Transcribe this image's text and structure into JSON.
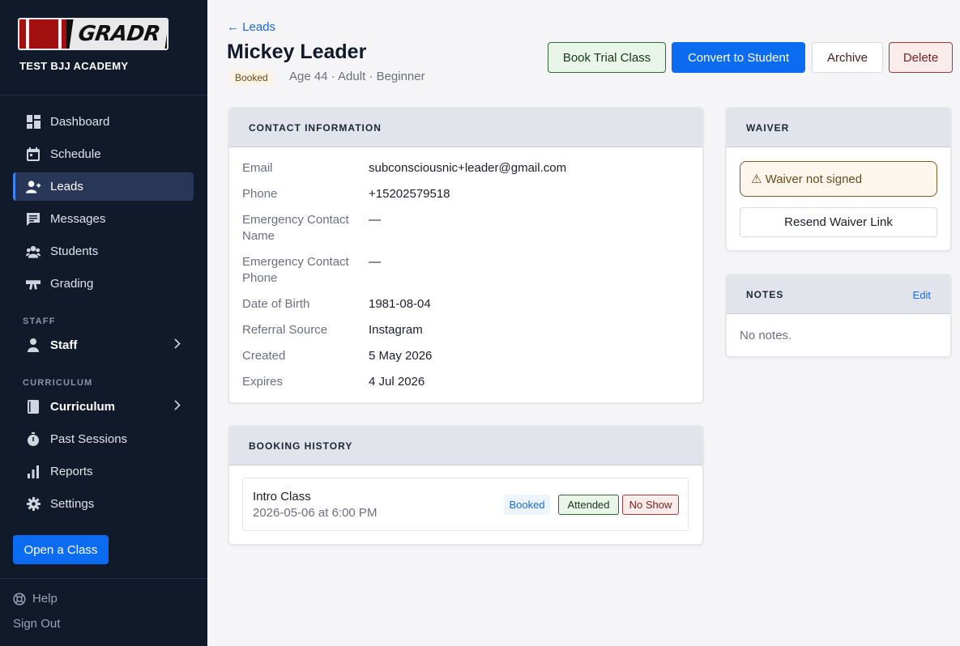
{
  "sidebar": {
    "logo_text": "GRADR",
    "academy": "TEST BJJ ACADEMY",
    "nav": [
      {
        "label": "Dashboard",
        "icon": "dashboard-icon"
      },
      {
        "label": "Schedule",
        "icon": "calendar-icon"
      },
      {
        "label": "Leads",
        "icon": "add-user-icon",
        "active": true
      },
      {
        "label": "Messages",
        "icon": "message-icon"
      },
      {
        "label": "Students",
        "icon": "group-icon"
      },
      {
        "label": "Grading",
        "icon": "belt-icon"
      }
    ],
    "staff_section": "STAFF",
    "staff": {
      "label": "Staff",
      "icon": "person-icon"
    },
    "curriculum_section": "CURRICULUM",
    "curriculum": {
      "label": "Curriculum",
      "icon": "book-icon"
    },
    "curriculum_nav": [
      {
        "label": "Past Sessions",
        "icon": "stopwatch-icon"
      },
      {
        "label": "Reports",
        "icon": "bar-chart-icon"
      },
      {
        "label": "Settings",
        "icon": "gear-icon"
      }
    ],
    "open_class": "Open a Class",
    "help": "Help",
    "sign_out": "Sign Out"
  },
  "header": {
    "back": "← Leads",
    "name": "Mickey Leader",
    "status": "Booked",
    "subtitle": "Age 44 · Adult · Beginner",
    "actions": {
      "book_trial": "Book Trial Class",
      "convert": "Convert to Student",
      "archive": "Archive",
      "delete": "Delete"
    }
  },
  "contact": {
    "title": "CONTACT INFORMATION",
    "rows": [
      {
        "label": "Email",
        "value": "subconsciousnic+leader@gmail.com"
      },
      {
        "label": "Phone",
        "value": "+15202579518"
      },
      {
        "label": "Emergency Contact Name",
        "value": "—"
      },
      {
        "label": "Emergency Contact Phone",
        "value": "—"
      },
      {
        "label": "Date of Birth",
        "value": "1981-08-04"
      },
      {
        "label": "Referral Source",
        "value": "Instagram"
      },
      {
        "label": "Created",
        "value": "5 May 2026"
      },
      {
        "label": "Expires",
        "value": "4 Jul 2026"
      }
    ]
  },
  "booking_history": {
    "title": "BOOKING HISTORY",
    "items": [
      {
        "title": "Intro Class",
        "date": "2026-05-06 at 6:00 PM",
        "status": "Booked",
        "attended_label": "Attended",
        "no_show_label": "No Show"
      }
    ]
  },
  "waiver": {
    "title": "WAIVER",
    "alert": "⚠ Waiver not signed",
    "resend": "Resend Waiver Link"
  },
  "notes": {
    "title": "NOTES",
    "edit": "Edit",
    "body": "No notes."
  },
  "colors": {
    "sidebar_bg": "#111a2b",
    "primary": "#0b6cf2",
    "success_bg": "#eaf5e9",
    "danger_bg": "#fbecec",
    "warning_bg": "#fdf6ec"
  }
}
